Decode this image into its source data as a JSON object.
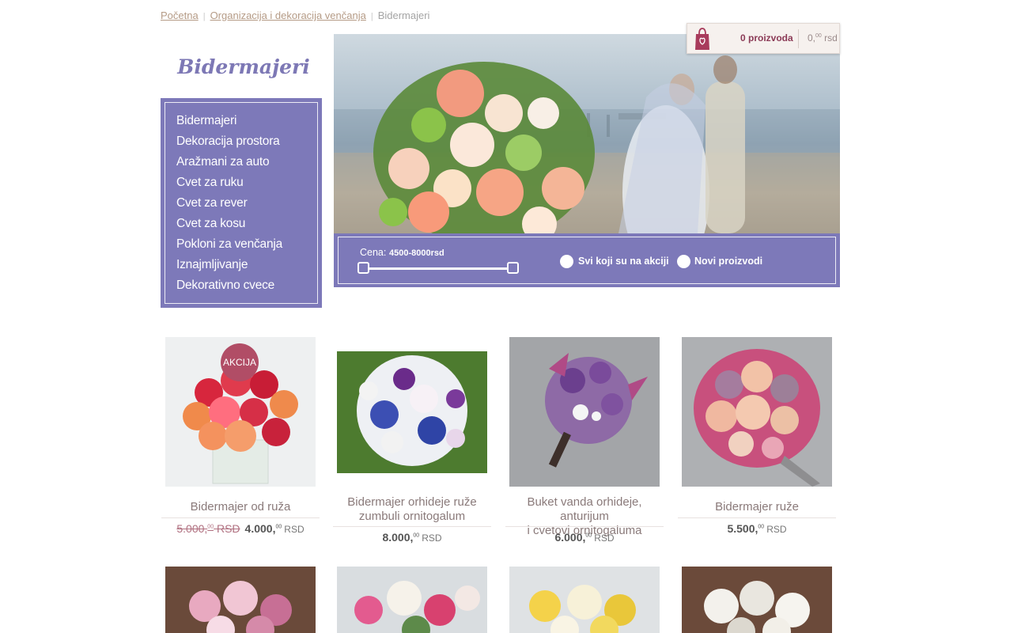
{
  "breadcrumb": {
    "home": "Početna",
    "parent": "Organizacija i dekoracija venčanja",
    "current": "Bidermajeri"
  },
  "sidebar": {
    "title": "Bidermajeri",
    "items": [
      {
        "label": "Bidermajeri"
      },
      {
        "label": "Dekoracija prostora"
      },
      {
        "label": "Aražmani za auto"
      },
      {
        "label": "Cvet za ruku"
      },
      {
        "label": "Cvet za rever"
      },
      {
        "label": "Cvet za kosu"
      },
      {
        "label": "Pokloni za venčanja"
      },
      {
        "label": "Iznajmljivanje"
      },
      {
        "label": "Dekorativno cvece"
      }
    ]
  },
  "cart": {
    "count_label": "0 proizvoda",
    "total_int": "0,",
    "total_dec": "00",
    "total_currency": "rsd",
    "icon": "shopping-bag-icon"
  },
  "filter": {
    "price_label": "Cena:",
    "price_range": "4500-8000rsd",
    "on_sale_label": "Svi koji su na akciji",
    "new_products_label": "Novi proizvodi"
  },
  "products": [
    {
      "title": "Bidermajer od ruža",
      "badge": "AKCIJA",
      "old_int": "5.000,",
      "old_dec": "00",
      "old_cur": "RSD",
      "price_int": "4.000,",
      "price_dec": "00",
      "price_cur": "RSD"
    },
    {
      "title_line1": "Bidermajer orhideje ruže",
      "title_line2": "zumbuli ornitogalum",
      "price_int": "8.000,",
      "price_dec": "00",
      "price_cur": "RSD"
    },
    {
      "title_line1": "Buket vanda orhideje, anturijum",
      "title_line2": "i cvetovi ornitogaluma",
      "price_int": "6.000,",
      "price_dec": "00",
      "price_cur": "RSD"
    },
    {
      "title": "Bidermajer ruže",
      "price_int": "5.500,",
      "price_dec": "00",
      "price_cur": "RSD"
    }
  ],
  "colors": {
    "accent_purple": "#7d79b9",
    "sale_badge": "#b14d66",
    "cart_text": "#8b3a56"
  }
}
